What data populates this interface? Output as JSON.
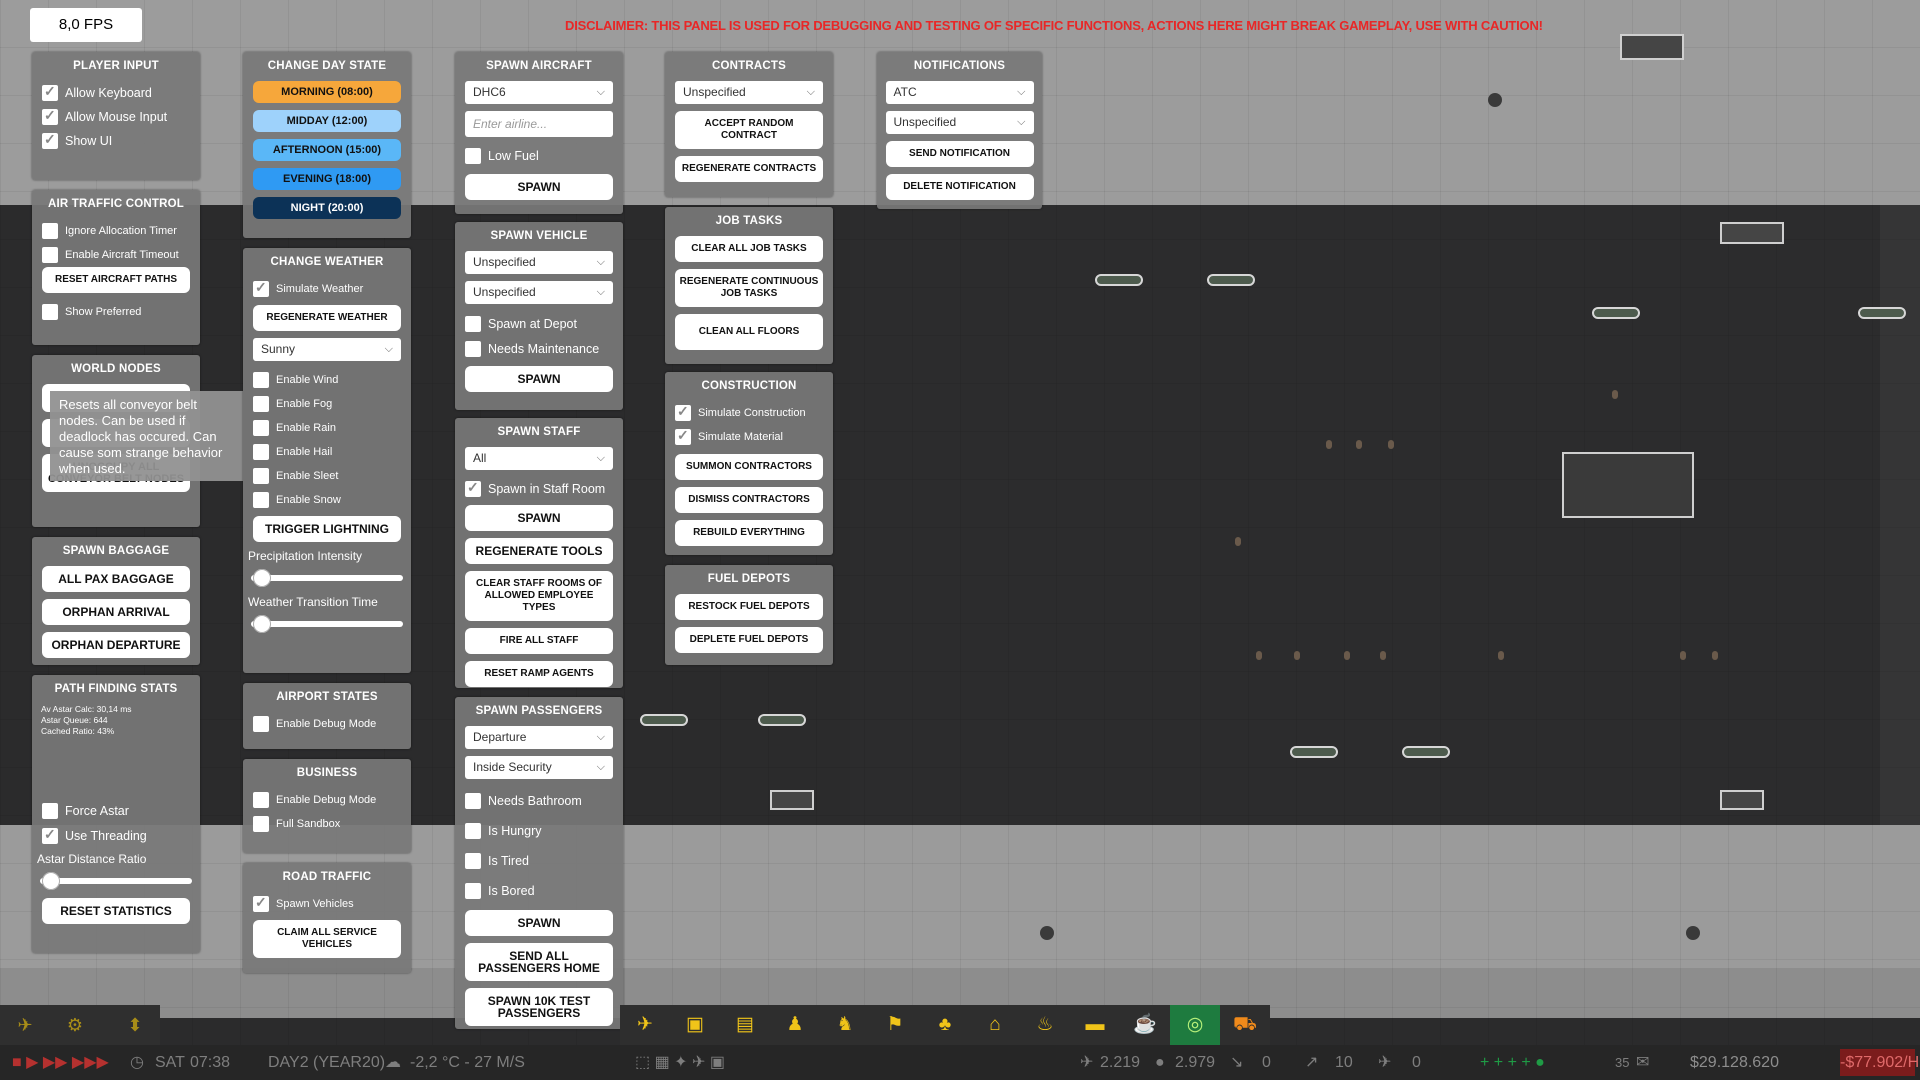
{
  "fps": "8,0 FPS",
  "disclaimer": "DISCLAIMER: THIS PANEL IS USED FOR DEBUGGING AND TESTING OF SPECIFIC FUNCTIONS, ACTIONS HERE MIGHT BREAK GAMEPLAY, USE WITH CAUTION!",
  "player_input": {
    "title": "PLAYER INPUT",
    "allow_keyboard": "Allow Keyboard",
    "allow_mouse": "Allow Mouse Input",
    "show_ui": "Show UI"
  },
  "atc": {
    "title": "AIR TRAFFIC CONTROL",
    "ignore_timer": "Ignore Allocation Timer",
    "aircraft_timeout": "Enable Aircraft Timeout",
    "reset_paths": "RESET AIRCRAFT PATHS",
    "show_preferred": "Show Preferred"
  },
  "world_nodes": {
    "title": "WORLD NODES",
    "unoccupy": "UNOCCUPY ALL CONVEYOR BELT NODES",
    "tooltip": "Resets all conveyor belt nodes. Can be used if deadlock has occured. Can cause som strange behavior when used."
  },
  "spawn_baggage": {
    "title": "SPAWN BAGGAGE",
    "all_pax": "ALL PAX BAGGAGE",
    "orphan_arrival": "ORPHAN ARRIVAL",
    "orphan_departure": "ORPHAN DEPARTURE"
  },
  "path_stats": {
    "title": "PATH FINDING STATS",
    "calc": "Av Astar Calc: 30,14 ms",
    "queue": "Astar Queue: 644",
    "cached": "Cached Ratio: 43%",
    "force_astar": "Force Astar",
    "use_threading": "Use Threading",
    "distance_ratio": "Astar Distance Ratio",
    "reset": "RESET STATISTICS"
  },
  "day_state": {
    "title": "CHANGE DAY STATE",
    "morning": "MORNING (08:00)",
    "midday": "MIDDAY (12:00)",
    "afternoon": "AFTERNOON (15:00)",
    "evening": "EVENING (18:00)",
    "night": "NIGHT (20:00)",
    "colors": {
      "morning": "#f6a73b",
      "midday": "#9ed2fb",
      "afternoon": "#5ab7f7",
      "evening": "#2f9af3",
      "night": "#0c3257"
    }
  },
  "weather": {
    "title": "CHANGE WEATHER",
    "simulate": "Simulate Weather",
    "regenerate": "REGENERATE WEATHER",
    "selected": "Sunny",
    "wind": "Enable Wind",
    "fog": "Enable Fog",
    "rain": "Enable Rain",
    "hail": "Enable Hail",
    "sleet": "Enable Sleet",
    "snow": "Enable Snow",
    "lightning": "TRIGGER LIGHTNING",
    "precip": "Precipitation Intensity",
    "transition": "Weather Transition Time"
  },
  "airport_states": {
    "title": "AIRPORT STATES",
    "debug": "Enable Debug Mode"
  },
  "business": {
    "title": "BUSINESS",
    "debug": "Enable Debug Mode",
    "sandbox": "Full Sandbox"
  },
  "road_traffic": {
    "title": "ROAD TRAFFIC",
    "spawn": "Spawn Vehicles",
    "claim": "CLAIM ALL SERVICE VEHICLES"
  },
  "spawn_aircraft": {
    "title": "SPAWN AIRCRAFT",
    "type": "DHC6",
    "airline_placeholder": "Enter airline...",
    "low_fuel": "Low Fuel",
    "spawn": "SPAWN"
  },
  "spawn_vehicle": {
    "title": "SPAWN VEHICLE",
    "sel1": "Unspecified",
    "sel2": "Unspecified",
    "depot": "Spawn at Depot",
    "maintenance": "Needs Maintenance",
    "spawn": "SPAWN"
  },
  "spawn_staff": {
    "title": "SPAWN STAFF",
    "sel": "All",
    "staff_room": "Spawn in Staff Room",
    "spawn": "SPAWN",
    "regen_tools": "REGENERATE TOOLS",
    "clear_rooms": "CLEAR STAFF ROOMS OF ALLOWED EMPLOYEE TYPES",
    "fire_all": "FIRE ALL STAFF",
    "reset_ramp": "RESET RAMP AGENTS"
  },
  "spawn_passengers": {
    "title": "SPAWN PASSENGERS",
    "sel1": "Departure",
    "sel2": "Inside Security",
    "bathroom": "Needs Bathroom",
    "hungry": "Is Hungry",
    "tired": "Is Tired",
    "bored": "Is Bored",
    "spawn": "SPAWN",
    "send_home": "SEND ALL PASSENGERS HOME",
    "spawn_10k": "SPAWN 10K TEST PASSENGERS"
  },
  "contracts": {
    "title": "CONTRACTS",
    "sel": "Unspecified",
    "accept": "ACCEPT RANDOM CONTRACT",
    "regen": "REGENERATE CONTRACTS"
  },
  "job_tasks": {
    "title": "JOB TASKS",
    "clear": "CLEAR ALL JOB TASKS",
    "regen": "REGENERATE CONTINUOUS JOB TASKS",
    "floors": "CLEAN ALL FLOORS"
  },
  "construction": {
    "title": "CONSTRUCTION",
    "sim_construction": "Simulate Construction",
    "sim_material": "Simulate Material",
    "summon": "SUMMON CONTRACTORS",
    "dismiss": "DISMISS CONTRACTORS",
    "rebuild": "REBUILD EVERYTHING"
  },
  "fuel_depots": {
    "title": "FUEL DEPOTS",
    "restock": "RESTOCK FUEL DEPOTS",
    "deplete": "DEPLETE FUEL DEPOTS"
  },
  "notifications": {
    "title": "NOTIFICATIONS",
    "sel1": "ATC",
    "sel2": "Unspecified",
    "send": "SEND NOTIFICATION",
    "delete": "DELETE NOTIFICATION"
  },
  "statusbar": {
    "day": "SAT",
    "time": "07:38",
    "date": "DAY2 (YEAR20)",
    "weather": "-2,2 °C - 27 M/S",
    "stat1": "2.219",
    "stat2": "2.979",
    "stat3": "0",
    "stat4": "10",
    "stat5": "0",
    "mail": "35",
    "money": "$29.128.620",
    "hourly": "-$77.902/H"
  }
}
